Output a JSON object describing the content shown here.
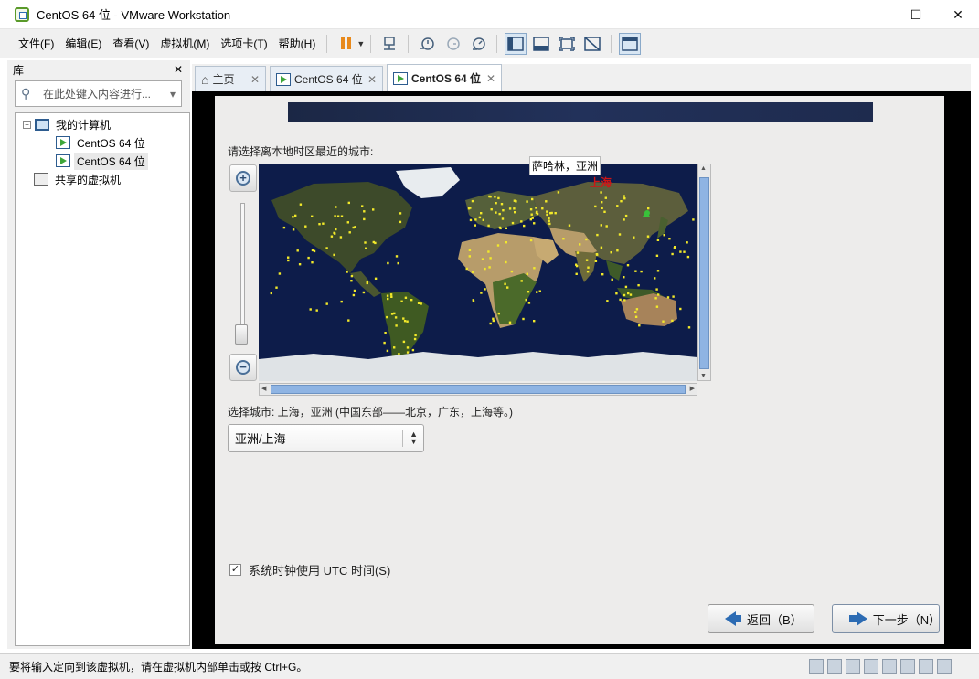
{
  "window": {
    "title": "CentOS 64 位 - VMware Workstation",
    "minimize": "—",
    "maximize": "☐",
    "close": "✕"
  },
  "menu": {
    "items": [
      "文件(F)",
      "编辑(E)",
      "查看(V)",
      "虚拟机(M)",
      "选项卡(T)",
      "帮助(H)"
    ]
  },
  "library": {
    "title": "库",
    "close": "✕",
    "search_placeholder": "在此处键入内容进行...",
    "search_dropdown": "▾",
    "tree": {
      "root_label": "我的计算机",
      "vm1": "CentOS 64 位",
      "vm2": "CentOS 64 位",
      "shared": "共享的虚拟机",
      "expander": "−"
    }
  },
  "tabs": {
    "home": "主页",
    "tab2": "CentOS 64 位",
    "tab3": "CentOS 64 位",
    "close": "✕"
  },
  "installer": {
    "prompt": "请选择离本地时区最近的城市:",
    "tooltip": "萨哈林，亚洲",
    "map_highlight": "上海",
    "selected_city_text": "选择城市: 上海，亚洲 (中国东部——北京，广东，上海等。)",
    "timezone_value": "亚洲/上海",
    "utc_checked": "✓",
    "utc_label": "系统时钟使用 UTC 时间(S)",
    "back_button": "返回（B）",
    "next_button": "下一步（N）",
    "zoom_in": "+",
    "zoom_out": "−"
  },
  "status": {
    "message": "要将输入定向到该虚拟机，请在虚拟机内部单击或按 Ctrl+G。"
  },
  "colors": {
    "accent_blue": "#2c6bb3",
    "map_ocean": "#0d1c4a",
    "city_dot": "#f2e92a",
    "highlight_red": "#d01515"
  }
}
